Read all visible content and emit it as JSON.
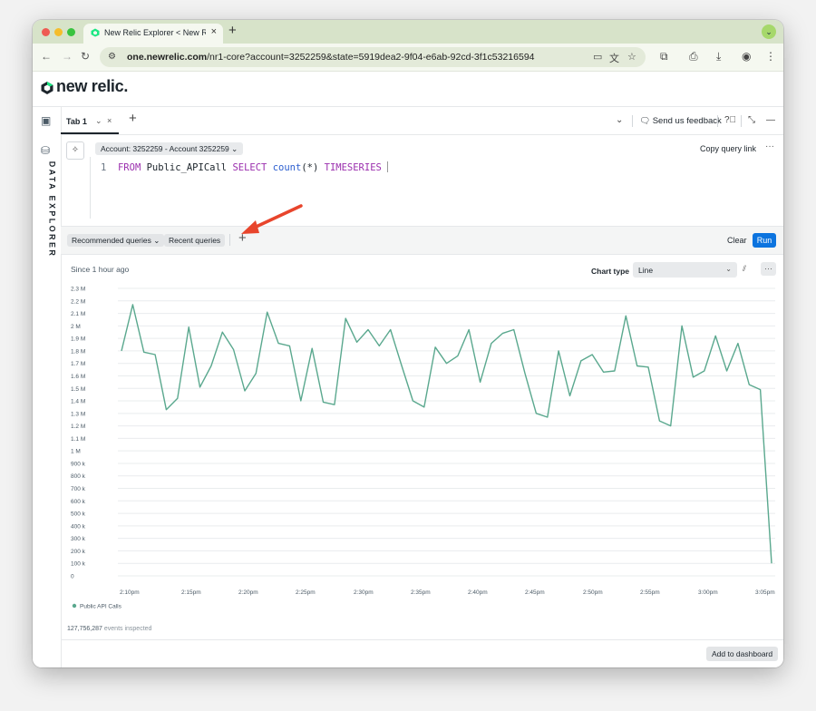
{
  "browser": {
    "tab_title": "New Relic Explorer < New Rel",
    "tab_close": "×",
    "new_tab": "+",
    "url_domain": "one.newrelic.com",
    "url_path": "/nr1-core?account=3252259&state=5919dea2-9f04-e6ab-92cd-3f1c53216594",
    "profile_glyph": "⌄",
    "icons": [
      "back-icon",
      "forward-icon",
      "reload-icon",
      "site-info-icon",
      "cast-icon",
      "translate-icon",
      "bookmark-star-icon",
      "extensions-icon",
      "print-icon",
      "download-icon",
      "account-icon",
      "menu-icon"
    ]
  },
  "app": {
    "brand": "new relic.",
    "rail_label": "DATA EXPLORER",
    "query_tab": "Tab 1",
    "feedback": "Send us feedback",
    "account_selector": "Account: 3252259 - Account 3252259 ⌄",
    "copy_link": "Copy query link",
    "query": {
      "line_number": "1",
      "tokens": {
        "from": "FROM",
        "table": "Public_APICall",
        "select": "SELECT",
        "fn": "count",
        "args": "(*)",
        "timeseries": "TIMESERIES"
      }
    },
    "recommended_queries": "Recommended queries ⌄",
    "recent_queries": "Recent queries",
    "clear": "Clear",
    "run": "Run",
    "since": "Since 1 hour ago",
    "chart_type_label": "Chart type",
    "chart_type_value": "Line",
    "events_inspected_count": "127,756,287",
    "events_inspected_suffix": "events inspected",
    "add_to_dashboard": "Add to dashboard",
    "accent_color": "#0c74df",
    "annotation_arrow_color": "#e8452c"
  },
  "chart_data": {
    "type": "line",
    "title": "",
    "xlabel": "",
    "ylabel": "",
    "ylim": [
      0,
      2300000
    ],
    "y_ticks": [
      "0",
      "100 k",
      "200 k",
      "300 k",
      "400 k",
      "500 k",
      "600 k",
      "700 k",
      "800 k",
      "900 k",
      "1 M",
      "1.1 M",
      "1.2 M",
      "1.3 M",
      "1.4 M",
      "1.5 M",
      "1.6 M",
      "1.7 M",
      "1.8 M",
      "1.9 M",
      "2 M",
      "2.1 M",
      "2.2 M",
      "2.3 M"
    ],
    "x_ticks": [
      "2:10pm",
      "2:15pm",
      "2:20pm",
      "2:25pm",
      "2:30pm",
      "2:35pm",
      "2:40pm",
      "2:45pm",
      "2:50pm",
      "2:55pm",
      "3:00pm",
      "3:05pm"
    ],
    "grid": true,
    "legend_position": "bottom-left",
    "series": [
      {
        "name": "Public API Calls",
        "color": "#5aa88e",
        "values": [
          1800000,
          2170000,
          1790000,
          1770000,
          1330000,
          1420000,
          1990000,
          1510000,
          1680000,
          1950000,
          1810000,
          1480000,
          1620000,
          2110000,
          1860000,
          1840000,
          1400000,
          1820000,
          1390000,
          1370000,
          2060000,
          1870000,
          1970000,
          1840000,
          1970000,
          1680000,
          1400000,
          1350000,
          1830000,
          1700000,
          1760000,
          1970000,
          1550000,
          1860000,
          1940000,
          1970000,
          1620000,
          1300000,
          1270000,
          1800000,
          1440000,
          1720000,
          1770000,
          1630000,
          1640000,
          2080000,
          1680000,
          1670000,
          1240000,
          1200000,
          2000000,
          1590000,
          1640000,
          1920000,
          1640000,
          1860000,
          1530000,
          1490000,
          100000
        ]
      }
    ]
  }
}
